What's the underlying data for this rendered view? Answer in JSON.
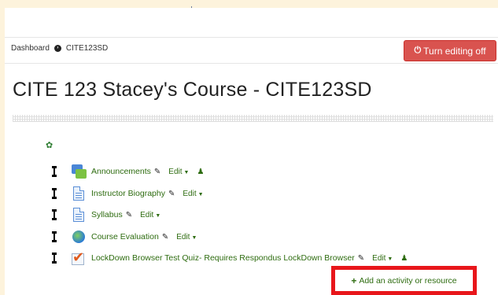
{
  "breadcrumb": {
    "items": [
      "Dashboard",
      "CITE123SD"
    ]
  },
  "header": {
    "edit_button": "Turn editing off",
    "edit_button_icon": "power-icon"
  },
  "course": {
    "title": "CITE 123 Stacey's Course - CITE123SD"
  },
  "activities": [
    {
      "name": "Announcements",
      "icon": "forum-icon",
      "edit_label": "Edit",
      "has_group_icon": true
    },
    {
      "name": "Instructor Biography",
      "icon": "page-icon",
      "edit_label": "Edit",
      "has_group_icon": false
    },
    {
      "name": "Syllabus",
      "icon": "page-icon",
      "edit_label": "Edit",
      "has_group_icon": false
    },
    {
      "name": "Course Evaluation",
      "icon": "feedback-icon",
      "edit_label": "Edit",
      "has_group_icon": false
    },
    {
      "name": "LockDown Browser Test Quiz- Requires Respondus LockDown Browser",
      "icon": "quiz-icon",
      "edit_label": "Edit",
      "has_group_icon": true
    }
  ],
  "add_activity": {
    "label": "Add an activity or resource"
  },
  "colors": {
    "accent_green": "#2e6c10",
    "danger_red": "#d9534f",
    "highlight_red": "#e8161b",
    "page_bg": "#fdf3dc"
  }
}
